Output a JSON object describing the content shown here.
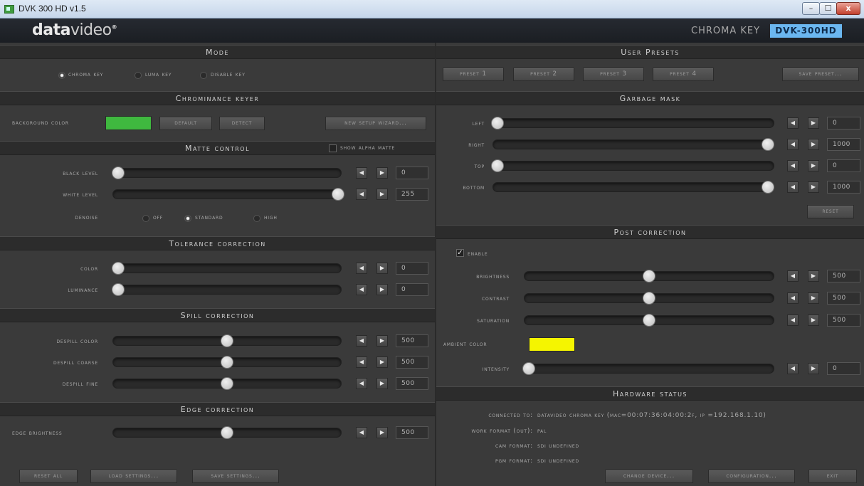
{
  "window": {
    "title": "DVK 300 HD v1.5",
    "min": "–",
    "max": "☐",
    "close": "x"
  },
  "header": {
    "logo_bold": "data",
    "logo_light": "video",
    "logo_mark": "®",
    "chroma_label": "CHROMA KEY",
    "model": "DVK-300HD"
  },
  "mode": {
    "title": "Mode",
    "options": [
      {
        "label": "Chroma key",
        "selected": true
      },
      {
        "label": "Luma key",
        "selected": false
      },
      {
        "label": "Disable key",
        "selected": false
      }
    ]
  },
  "chroma": {
    "title": "Chrominance keyer",
    "bg_label": "Background color",
    "bg_color": "#3fb83f",
    "default_btn": "Default",
    "detect_btn": "Detect",
    "wizard_btn": "New setup wizard..."
  },
  "matte": {
    "title": "Matte control",
    "show_alpha": "Show alpha matte",
    "black_label": "Black level",
    "black_value": "0",
    "white_label": "White level",
    "white_value": "255",
    "denoise_label": "Denoise",
    "denoise_options": [
      {
        "label": "Off",
        "selected": false
      },
      {
        "label": "Standard",
        "selected": true
      },
      {
        "label": "High",
        "selected": false
      }
    ]
  },
  "tolerance": {
    "title": "Tolerance correction",
    "color_label": "Color",
    "color_value": "0",
    "lum_label": "Luminance",
    "lum_value": "0"
  },
  "spill": {
    "title": "Spill correction",
    "color_label": "Despill color",
    "color_value": "500",
    "coarse_label": "Despill coarse",
    "coarse_value": "500",
    "fine_label": "Despill fine",
    "fine_value": "500"
  },
  "edge": {
    "title": "Edge correction",
    "bright_label": "Edge brightness",
    "bright_value": "500"
  },
  "bottom_left": {
    "reset_all": "Reset all",
    "load": "Load settings...",
    "save": "Save settings..."
  },
  "presets": {
    "title": "User Presets",
    "items": [
      "Preset 1",
      "Preset 2",
      "Preset 3",
      "Preset 4"
    ],
    "save": "Save preset..."
  },
  "garbage": {
    "title": "Garbage mask",
    "left_label": "Left",
    "left_value": "0",
    "right_label": "Right",
    "right_value": "1000",
    "top_label": "Top",
    "top_value": "0",
    "bottom_label": "Bottom",
    "bottom_value": "1000",
    "reset": "Reset"
  },
  "post": {
    "title": "Post correction",
    "enable_label": "Enable",
    "brightness_label": "Brightness",
    "brightness_value": "500",
    "contrast_label": "Contrast",
    "contrast_value": "500",
    "saturation_label": "Saturation",
    "saturation_value": "500",
    "ambient_label": "Ambient color",
    "ambient_color": "#f5f500",
    "intensity_label": "Intensity",
    "intensity_value": "0"
  },
  "hardware": {
    "title": "Hardware status",
    "connected_label": "Connected to:",
    "connected_value": "Datavideo chroma key (mac=00:07:36:04:00:2f, ip =192.168.1.10)",
    "work_label": "Work format (out):",
    "work_value": "PAL",
    "cam_label": "Cam format:",
    "cam_value": "SDI undefined",
    "pgm_label": "Pgm format:",
    "pgm_value": "SDI undefined",
    "change": "Change device...",
    "config": "Configuration...",
    "exit": "Exit"
  },
  "icons": {
    "left_arrow": "◀",
    "right_arrow": "▶",
    "check": "✓"
  }
}
